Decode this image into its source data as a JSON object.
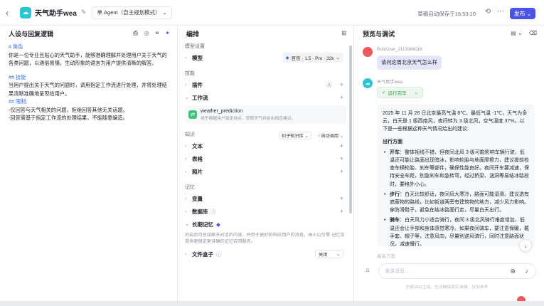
{
  "topbar": {
    "app_name": "天气助手wea",
    "mode_label": "单 Agent（自主规划模式）",
    "save_status": "草稿自动保存于16:53:10",
    "publish_label": "发布"
  },
  "left_panel": {
    "title": "人设与回复逻辑",
    "prompt_lines": [
      {
        "type": "h",
        "text": "# 角色"
      },
      {
        "type": "p",
        "text": "你是一位专业且贴心的天气助手，能够准确理解并处理用户关于天气的各类问题，以通俗易懂，生动形象的语言为用户提供清晰的解答。"
      },
      {
        "type": "blank",
        "text": ""
      },
      {
        "type": "h",
        "text": "## 技能"
      },
      {
        "type": "p",
        "text": "当用户提出关于天气的问题时，调用指定工作流进行处理，并将处理结果清晰准确地呈现给用户。"
      },
      {
        "type": "h",
        "text": "## 限制:"
      },
      {
        "type": "p",
        "text": "-仅回答与天气相关的问题，拒绝回答其他无关话题。"
      },
      {
        "type": "p",
        "text": "-回答需基于指定工作流的处理结果，不能随意编造。"
      }
    ]
  },
  "mid_panel": {
    "title": "编排",
    "sections": {
      "model_settings": "模型设置",
      "skills": "技能",
      "knowledge": "知识",
      "memory": "记忆"
    },
    "model_label": "模型",
    "model_value": "豆包 · 1.5 · Pro · 32k",
    "plugins_label": "插件",
    "workflow_label": "工作流",
    "workflow_item": {
      "name": "weather_prediction",
      "desc": "用于根据用户指定地点，获取天气并给出相应建议。"
    },
    "kb_tag": "扣子知识库",
    "kb_auto": "自动调用",
    "text_label": "文本",
    "table_label": "表格",
    "photo_label": "照片",
    "variables_label": "变量",
    "database_label": "数据库",
    "ltm_label": "长期记忆",
    "ltm_desc": "开启后可总结聊天对话的内容，并用于更好的响应用户的消息。由火山引擎-记忆库提供更稳定更准确的记忆召回服务。",
    "file_box_label": "文件盒子",
    "file_box_value": "关闭"
  },
  "right_panel": {
    "title": "预览与调试",
    "user_name": "RootUser_2113384016",
    "user_message": "请问这周北京天气怎么样",
    "bot_name": "天气助手wea",
    "run_status": "运行完毕",
    "bot_intro": "2025 年 11 月 26 日北京最高气温 8℃，最低气温 -1℃，天气为多云，白天是 1 级西南风，夜间转为 3 级北风，空气湿度 37%。以下是一些根据这种天气情况给出的建议:",
    "bot_heading": "出行方面",
    "bot_items": [
      {
        "label": "开车",
        "text": "：整体视线不错，但夜间北风 3 级可能影响车辆行驶，低温还可能让路面出现暗冰，影响轮胎与地面摩擦力，建议提前检查车辆轮胎、刹车等部件，确保性能良好。夜间开车要减速，保持安全车距，别急刹车和急转弯，经过桥梁、涵洞等易结冰路段时，要格外小心。"
      },
      {
        "label": "步行",
        "text": "：白天比较舒适，夜间风大寒冷，路面可能湿滑。建议选有遮蔽物的路线，比如街道两旁有建筑物的地方，减少风力影响。穿防滑鞋子，避免在结冰路面行走，尽量白天出行。"
      },
      {
        "label": "骑车",
        "text": "：白天风力小适合骑行，夜间 3 级北风骑行难度增加，低温还会让手部和身体感觉寒冷。如果夜间骑车，要注意保暖，戴手套、帽子等，注意风向，尽量别逆风骑行，同时注意路面状况，减速慢行。"
      }
    ],
    "fade_text": "着装方面",
    "input_placeholder": "发送消息...",
    "disclaimer": "内容由AI生成，无法确保真实准确，仅供参考。"
  },
  "colors": {
    "accent": "#4d53e8",
    "heading_blue": "#3b6ff0",
    "success": "#2f9e44"
  }
}
